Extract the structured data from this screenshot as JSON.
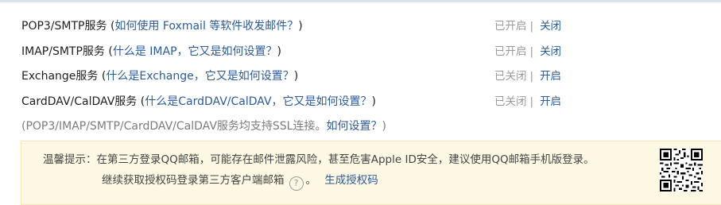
{
  "services": [
    {
      "name": "POP3/SMTP服务",
      "help_link": "如何使用 Foxmail 等软件收发邮件？",
      "state": "已开启",
      "action": "关闭"
    },
    {
      "name": "IMAP/SMTP服务",
      "help_link": "什么是 IMAP，它又是如何设置？",
      "state": "已开启",
      "action": "关闭"
    },
    {
      "name": "Exchange服务",
      "help_link": "什么是Exchange，它又是如何设置？",
      "state": "已关闭",
      "action": "开启"
    },
    {
      "name": "CardDAV/CalDAV服务",
      "help_link": "什么是CardDAV/CalDAV，它又是如何设置？",
      "state": "已关闭",
      "action": "开启"
    }
  ],
  "paren_open": "(",
  "paren_close": ")",
  "separator": "|",
  "ssl_note": {
    "text": "(POP3/IMAP/SMTP/CardDAV/CalDAV服务均支持SSL连接。",
    "link": "如何设置？",
    "close": ")"
  },
  "tip": {
    "label": "温馨提示：",
    "message": "在第三方登录QQ邮箱，可能存在邮件泄露风险，甚至危害Apple ID安全，建议使用QQ邮箱手机版登录。",
    "line2": "继续获取授权码登录第三方客户端邮箱",
    "help_icon": "question-circle-icon",
    "help_glyph": "?",
    "period": "。",
    "generate_link": "生成授权码",
    "qr_icon": "qr-code-icon"
  },
  "colors": {
    "link": "#2b5b9a",
    "muted": "#9a9a9a",
    "tip_bg": "#fdf8e4",
    "tip_border": "#f3e6b5"
  }
}
